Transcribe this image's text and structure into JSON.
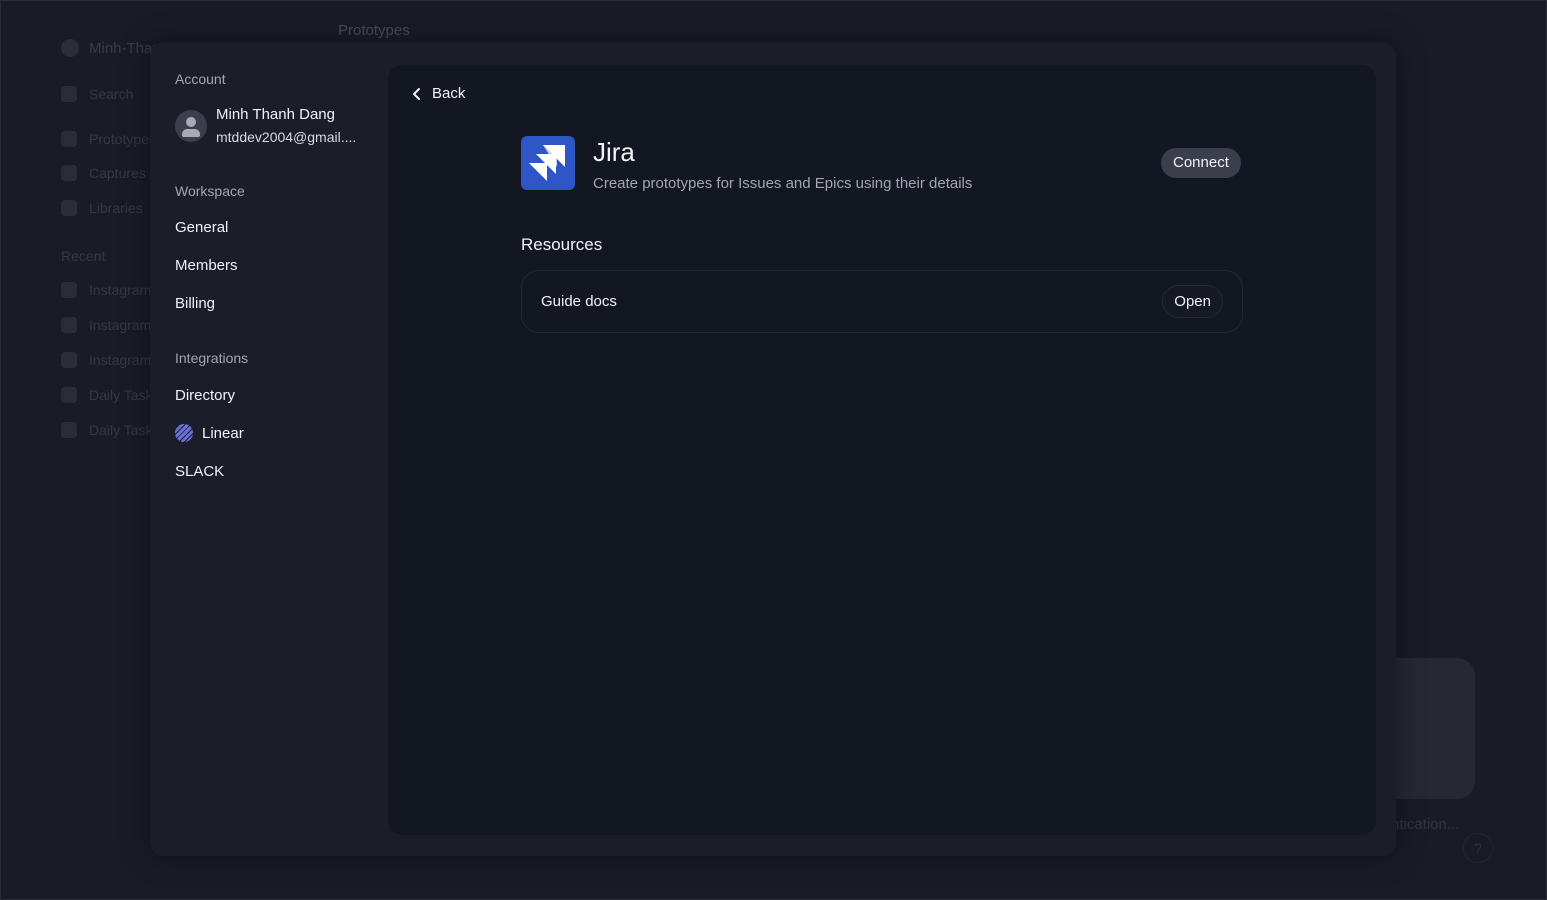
{
  "background": {
    "workspace": "Minh-Thanh",
    "top_tab": "Prototypes",
    "search": "Search",
    "nav": [
      "Prototypes",
      "Captures",
      "Libraries"
    ],
    "recent_label": "Recent",
    "recent": [
      "Instagram",
      "Instagram",
      "Instagram",
      "Daily Task",
      "Daily Task"
    ],
    "status": "ntication...",
    "help": "?"
  },
  "sidebar": {
    "account_label": "Account",
    "user": {
      "name": "Minh Thanh Dang",
      "email": "mtddev2004@gmail...."
    },
    "workspace_label": "Workspace",
    "workspace_items": [
      "General",
      "Members",
      "Billing"
    ],
    "integrations_label": "Integrations",
    "integration_items": [
      "Directory",
      "Linear",
      "SLACK"
    ]
  },
  "main": {
    "back_label": "Back",
    "integration": {
      "name": "Jira",
      "description": "Create prototypes for Issues and Epics using their details",
      "connect_label": "Connect",
      "brand_color": "#2f56c6"
    },
    "resources_label": "Resources",
    "resources": [
      {
        "label": "Guide docs",
        "action": "Open"
      }
    ]
  }
}
